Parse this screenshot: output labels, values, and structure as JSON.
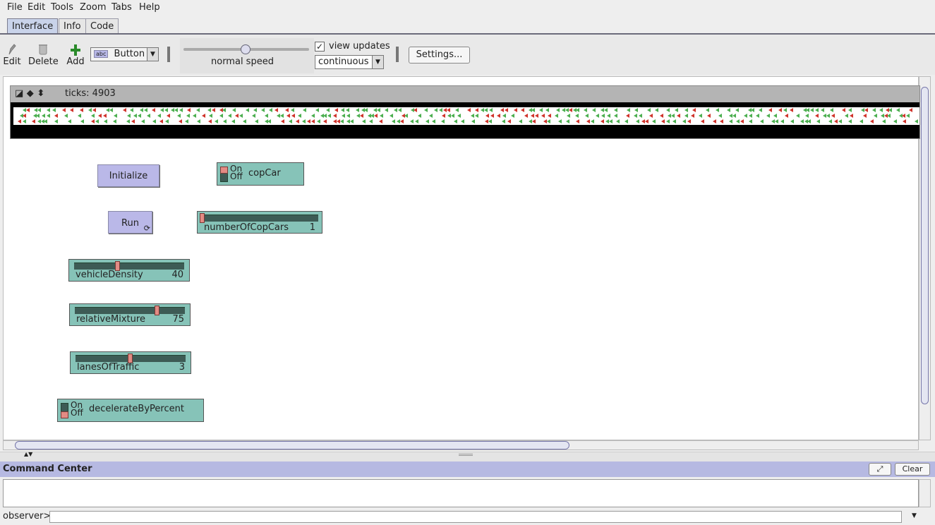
{
  "menu": [
    "File",
    "Edit",
    "Tools",
    "Zoom",
    "Tabs",
    "Help"
  ],
  "tabs": [
    "Interface",
    "Info",
    "Code"
  ],
  "toolbar": {
    "edit_label": "Edit",
    "delete_label": "Delete",
    "add_label": "Add",
    "widget_type": "Button",
    "widget_type_icon": "abc",
    "speed_label": "normal speed",
    "view_updates_label": "view updates",
    "view_updates_checked": "✓",
    "update_mode": "continuous",
    "settings_label": "Settings..."
  },
  "view": {
    "ticks_label": "ticks: 4903"
  },
  "widgets": {
    "initialize_label": "Initialize",
    "run_label": "Run",
    "copcar": {
      "on": "On",
      "off": "Off",
      "label": "copCar"
    },
    "numberOfCopCars": {
      "label": "numberOfCopCars",
      "value": "1"
    },
    "vehicleDensity": {
      "label": "vehicleDensity",
      "value": "40"
    },
    "relativeMixture": {
      "label": "relativeMixture",
      "value": "75"
    },
    "lanesOfTraffic": {
      "label": "lanesOfTraffic",
      "value": "3"
    },
    "decelerate": {
      "on": "On",
      "off": "Off",
      "label": "decelerateByPercent"
    }
  },
  "command_center": {
    "title": "Command Center",
    "clear_label": "Clear",
    "observer_label": "observer>"
  },
  "colors": {
    "widget_teal": "#86c3b8",
    "button_purple": "#bab8e8",
    "cc_bar": "#b6b9e2",
    "car_green": "#4caf50",
    "car_red": "#d0342c"
  }
}
